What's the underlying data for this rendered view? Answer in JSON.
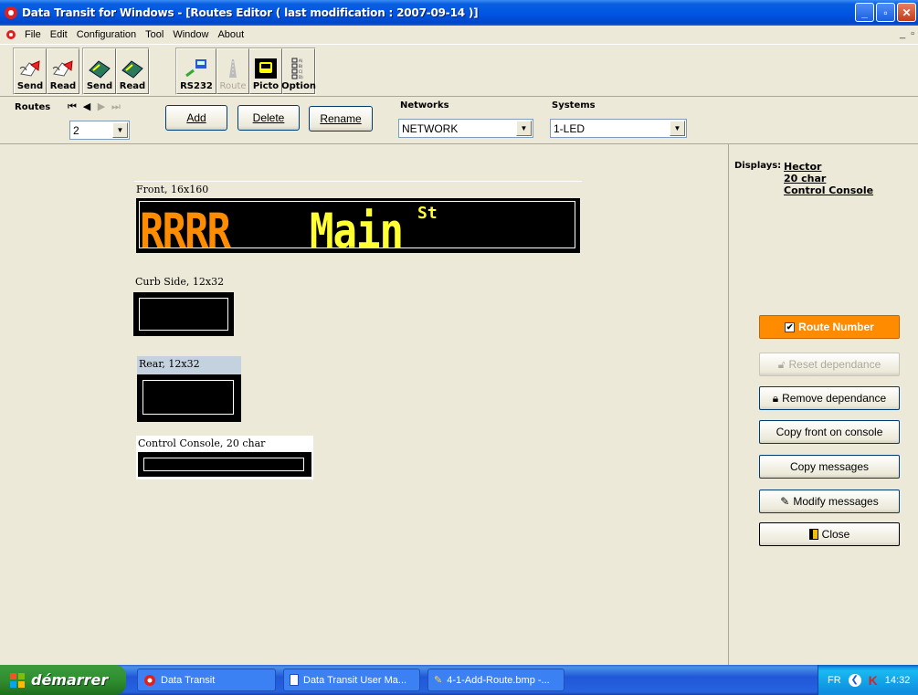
{
  "window": {
    "title": "Data Transit for Windows - [Routes Editor ( last modification : 2007-09-14 )]",
    "min": "_",
    "max": "▫",
    "close": "✕"
  },
  "menu": {
    "items": [
      "File",
      "Edit",
      "Configuration",
      "Tool",
      "Window",
      "About"
    ],
    "mdi_min": "_",
    "mdi_max": "▫"
  },
  "toolbar": {
    "buttons": [
      {
        "label": "Send",
        "icon": "send-ticket-icon"
      },
      {
        "label": "Read",
        "icon": "read-ticket-icon"
      },
      {
        "label": "Send",
        "icon": "send-card-icon"
      },
      {
        "label": "Read",
        "icon": "read-card-icon"
      },
      {
        "label": "RS232",
        "icon": "rs232-icon"
      },
      {
        "label": "Route",
        "icon": "route-icon",
        "disabled": true
      },
      {
        "label": "Picto",
        "icon": "picto-icon"
      },
      {
        "label": "Option",
        "icon": "option-icon"
      }
    ]
  },
  "routes": {
    "label": "Routes",
    "selected": "2",
    "add": "Add",
    "delete": "Delete",
    "rename": "Rename",
    "networks_label": "Networks",
    "network_value": "NETWORK",
    "systems_label": "Systems",
    "system_value": "1-LED"
  },
  "displays": {
    "front": {
      "title": "Front, 16x160",
      "route_text": "RRRR",
      "dest_text": "Main",
      "dest_super": "St"
    },
    "curb": {
      "title": "Curb Side, 12x32"
    },
    "rear": {
      "title": "Rear, 12x32"
    },
    "console": {
      "title": "Control Console, 20 char"
    }
  },
  "side": {
    "displays_label": "Displays:",
    "display_links": [
      "Hector",
      "20 char",
      "Control Console"
    ],
    "route_number": "Route Number",
    "reset_dependance": "Reset dependance",
    "remove_dependance": "Remove dependance",
    "copy_front": "Copy front on console",
    "copy_messages": "Copy messages",
    "modify_messages": "Modify messages",
    "close": "Close"
  },
  "taskbar": {
    "start": "démarrer",
    "tasks": [
      "Data Transit",
      "Data Transit User Ma...",
      "4-1-Add-Route.bmp -..."
    ],
    "lang": "FR",
    "time": "14:32"
  },
  "colors": {
    "led_orange": "#ff8c00",
    "led_yellow": "#ffff33",
    "route_button": "#ff8c00"
  }
}
